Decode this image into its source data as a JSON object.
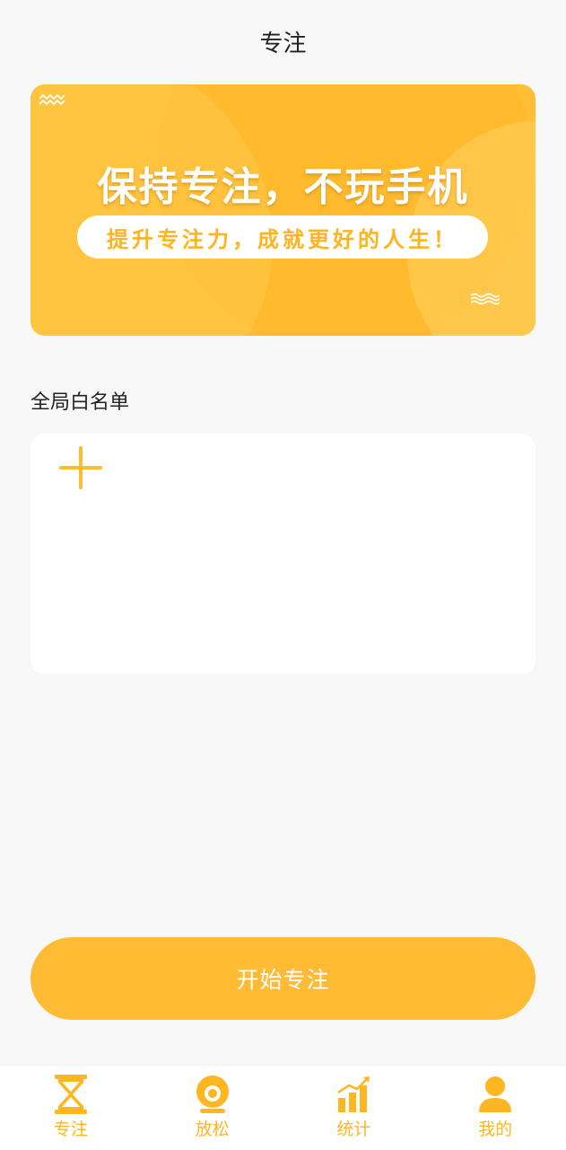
{
  "header": {
    "title": "专注"
  },
  "banner": {
    "headline": "保持专注，不玩手机",
    "subline": "提升专注力，成就更好的人生！"
  },
  "whitelist": {
    "label": "全局白名单"
  },
  "start_button": {
    "label": "开始专注"
  },
  "tabbar": {
    "items": [
      {
        "label": "专注",
        "icon": "hourglass-icon"
      },
      {
        "label": "放松",
        "icon": "relax-icon"
      },
      {
        "label": "统计",
        "icon": "chart-icon"
      },
      {
        "label": "我的",
        "icon": "user-icon"
      }
    ]
  },
  "colors": {
    "accent": "#ffbb33",
    "background": "#f8f8f8"
  }
}
